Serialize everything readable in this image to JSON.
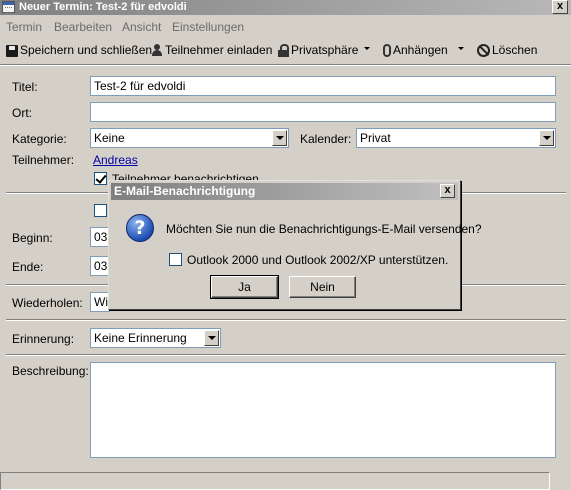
{
  "window": {
    "title": "Neuer Termin: Test-2 für edvoldi",
    "close_label": "x"
  },
  "menu": [
    {
      "label": "Termin"
    },
    {
      "label": "Bearbeiten"
    },
    {
      "label": "Ansicht"
    },
    {
      "label": "Einstellungen"
    }
  ],
  "toolbar": {
    "save_label": "Speichern und schließen",
    "invite_label": "Teilnehmer einladen",
    "privacy_label": "Privatsphäre",
    "attach_label": "Anhängen",
    "delete_label": "Löschen"
  },
  "form": {
    "title_label": "Titel:",
    "title_value": "Test-2 für edvoldi",
    "location_label": "Ort:",
    "location_value": "",
    "category_label": "Kategorie:",
    "category_value": "Keine",
    "calendar_label": "Kalender:",
    "calendar_value": "Privat",
    "attendees_label": "Teilnehmer:",
    "attendee_name": "Andreas",
    "notify_attendees_label": "Teilnehmer benachrichtigen",
    "notify_attendees_checked": true,
    "allday_checked": false,
    "begin_label": "Beginn:",
    "begin_value": "03",
    "end_label": "Ende:",
    "end_value": "03",
    "repeat_label": "Wiederholen:",
    "repeat_value": "Wie",
    "reminder_label": "Erinnerung:",
    "reminder_value": "Keine Erinnerung",
    "description_label": "Beschreibung:",
    "description_value": ""
  },
  "dialog": {
    "title": "E-Mail-Benachrichtigung",
    "message": "Möchten Sie nun die Benachrichtigungs-E-Mail versenden?",
    "checkbox_label": "Outlook 2000 und Outlook 2002/XP unterstützen.",
    "checkbox_checked": false,
    "yes_label": "Ja",
    "no_label": "Nein",
    "icon": "question-icon",
    "close_label": "x"
  }
}
